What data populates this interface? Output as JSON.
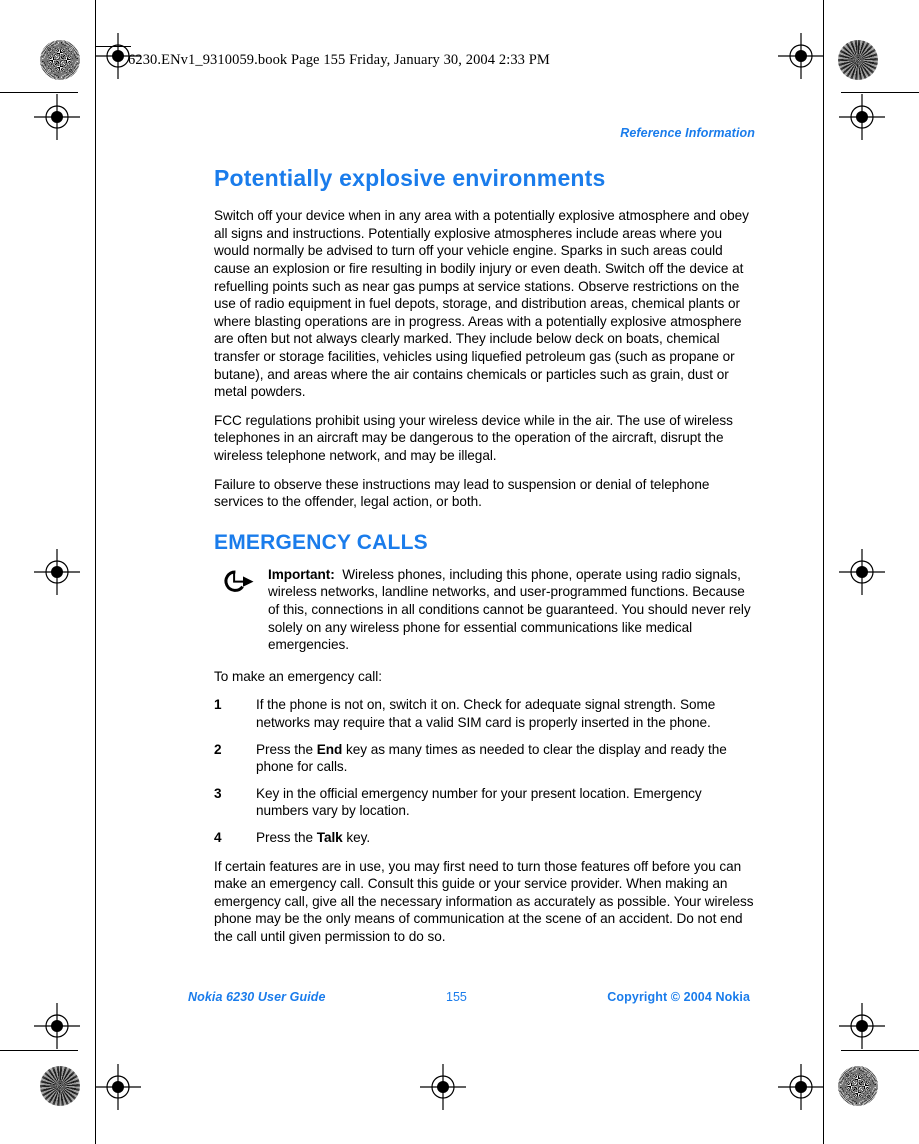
{
  "print_header": "6230.ENv1_9310059.book  Page 155  Friday, January 30, 2004  2:33 PM",
  "running_head": "Reference Information",
  "colors": {
    "accent_blue": "#1a7ceb",
    "body_text": "#000000",
    "page_background": "#ffffff"
  },
  "sections": {
    "explosive": {
      "title": "Potentially explosive environments",
      "paragraphs": [
        "Switch off your device when in any area with a potentially explosive atmosphere and obey all signs and instructions. Potentially explosive atmospheres include areas where you would normally be advised to turn off your vehicle engine. Sparks in such areas could cause an explosion or fire resulting in bodily injury or even death. Switch off the device at refuelling points such as near gas pumps at service stations. Observe restrictions on the use of radio equipment in fuel depots, storage, and distribution areas, chemical plants or where blasting operations are in progress. Areas with a potentially explosive atmosphere are often but not always clearly marked. They include below deck on boats, chemical transfer or storage facilities, vehicles using liquefied petroleum gas (such as propane or butane), and areas where the air contains chemicals or particles such as grain, dust or metal powders.",
        "FCC regulations prohibit using your wireless device while in the air. The use of wireless telephones in an aircraft may be dangerous to the operation of the aircraft, disrupt the wireless telephone network, and may be illegal.",
        "Failure to observe these instructions may lead to suspension or denial of telephone services to the offender, legal action, or both."
      ]
    },
    "emergency": {
      "title": "EMERGENCY CALLS",
      "note": {
        "icon": "important-arrow-icon",
        "label": "Important:",
        "text": "Wireless phones, including this phone, operate using radio signals, wireless networks, landline networks, and user-programmed functions. Because of this, connections in all conditions cannot be guaranteed. You should never rely solely on any wireless phone for essential communications like medical emergencies."
      },
      "intro": "To make an emergency call:",
      "steps": [
        {
          "num": "1",
          "parts": [
            {
              "text": "If the phone is not on, switch it on. Check for adequate signal strength. Some networks may require that a valid SIM card is properly inserted in the phone.",
              "bold": false
            }
          ]
        },
        {
          "num": "2",
          "parts": [
            {
              "text": "Press the ",
              "bold": false
            },
            {
              "text": "End",
              "bold": true
            },
            {
              "text": " key as many times as needed to clear the display and ready the phone for calls.",
              "bold": false
            }
          ]
        },
        {
          "num": "3",
          "parts": [
            {
              "text": "Key in the official emergency number for your present location. Emergency numbers vary by location.",
              "bold": false
            }
          ]
        },
        {
          "num": "4",
          "parts": [
            {
              "text": "Press the ",
              "bold": false
            },
            {
              "text": "Talk",
              "bold": true
            },
            {
              "text": " key.",
              "bold": false
            }
          ]
        }
      ],
      "closing": "If certain features are in use, you may first need to turn those features off before you can make an emergency call. Consult this guide or your service provider. When making an emergency call, give all the necessary information as accurately as possible. Your wireless phone may be the only means of communication at the scene of an accident. Do not end the call until given permission to do so."
    }
  },
  "footer": {
    "left": "Nokia 6230 User Guide",
    "page_number": "155",
    "right": "Copyright © 2004 Nokia"
  }
}
